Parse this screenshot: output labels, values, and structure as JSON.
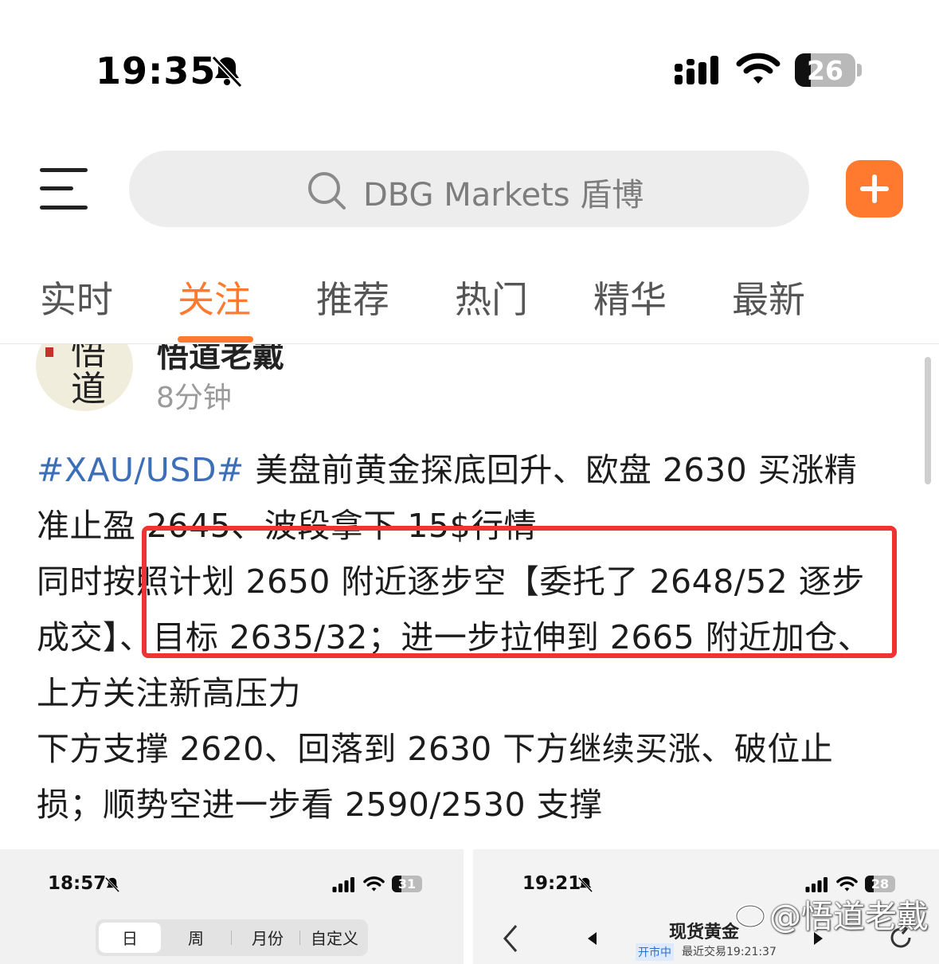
{
  "status_bar": {
    "time": "19:35",
    "battery": "26",
    "battery_level_percent": 26
  },
  "header": {
    "search_placeholder": "DBG Markets 盾博"
  },
  "tabs": [
    {
      "label": "实时"
    },
    {
      "label": "关注",
      "active": true
    },
    {
      "label": "推荐"
    },
    {
      "label": "热门"
    },
    {
      "label": "精华"
    },
    {
      "label": "最新"
    }
  ],
  "post": {
    "author": "悟道老戴",
    "time": "8分钟",
    "avatar_text": "悟道",
    "hashtag": "#XAU/USD#",
    "lines": [
      " 美盘前黄金探底回升、欧盘 2630 买涨精",
      "准止盈 2645、波段拿下 15$行情",
      "同时按照计划 2650 附近逐步空【委托了 2648/52 逐步",
      "成交】、目标 2635/32；进一步拉伸到 2665 附近加仓、",
      "上方关注新高压力",
      "下方支撑 2620、回落到 2630 下方继续买涨、破位止",
      "损；顺势空进一步看 2590/2530 支撑"
    ]
  },
  "images": [
    {
      "time": "18:57",
      "battery": "31",
      "battery_level_percent": 31,
      "segments": [
        "日",
        "周",
        "月份",
        "自定义"
      ]
    },
    {
      "time": "19:21",
      "battery": "28",
      "battery_level_percent": 28,
      "title": "现货黄金",
      "badge": "开市中",
      "subtitle": "最近交易19:21:37",
      "watermark": "@悟道老戴"
    }
  ],
  "colors": {
    "accent": "#ff7a2e",
    "hashtag": "#3d6fb8",
    "highlight": "#ee3333"
  }
}
